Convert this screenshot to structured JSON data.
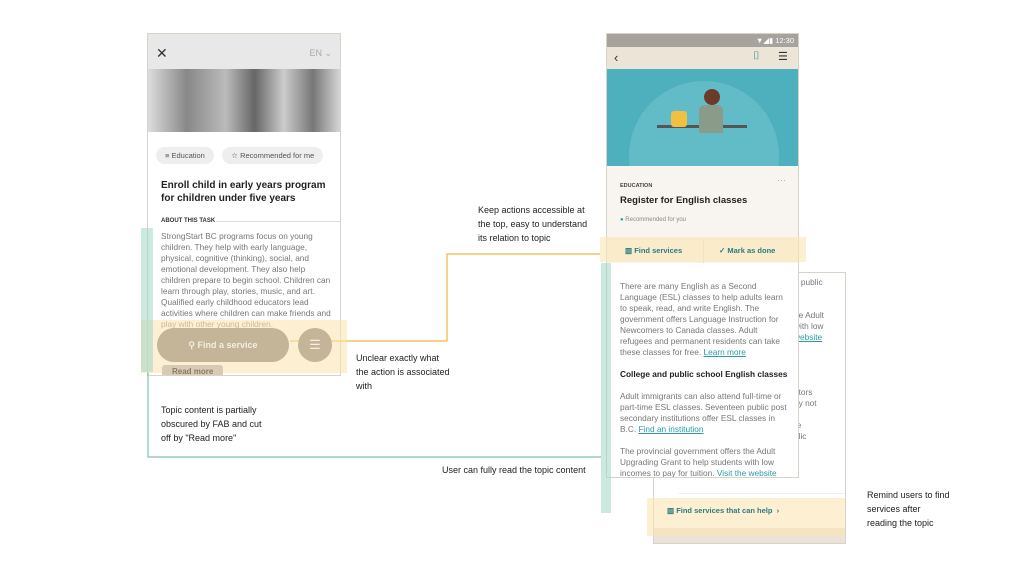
{
  "left_phone": {
    "lang": "EN",
    "tags": [
      "Education",
      "Recommended for me"
    ],
    "title": "Enroll child in early years program for children under five years",
    "section_label": "ABOUT THIS TASK",
    "body": "StrongStart BC programs focus on young children. They help with early language, physical, cognitive (thinking), social, and emotional development. They also help children prepare to begin school. Children can learn through play, stories, music, and art. Qualified early childhood educators lead activities where children can make friends and play with other young children.",
    "fab_label": "Find a service",
    "read_more": "Read more"
  },
  "right_phone": {
    "status_time": "12:30",
    "category": "EDUCATION",
    "title": "Register for English classes",
    "recommended": "Recommended for you",
    "find_services": "Find services",
    "mark_done": "Mark as done",
    "para1": "There are many English as a Second Language (ESL) classes to help adults learn to speak, read, and write English. The government offers Language Instruction for Newcomers to Canada classes. Adult refugees and permanent residents can take these classes for free.",
    "learn_more": "Learn more",
    "heading2": "College and public school English classes",
    "para2": "Adult immigrants can also attend full-time or part-time ESL classes. Seventeen public post secondary institutions offer ESL classes in B.C.",
    "find_institution": "Find an institution",
    "para3": "The provincial government offers the Adult Upgrading Grant to help students with low incomes to pay for tuition.",
    "visit_website": "Visit the website"
  },
  "back_panel": {
    "lines": [
      "n public",
      "L",
      "",
      "he Adult",
      "with low",
      "website",
      "",
      "s",
      "",
      "utors",
      "ay not",
      "",
      "re",
      "blic"
    ],
    "find_services_help": "Find services that can help"
  },
  "annotations": {
    "keep_actions": "Keep actions accessible at the top, easy to understand its relation to topic",
    "unclear_action": "Unclear exactly what the action is associated with",
    "topic_obscured": "Topic content is partially obscured by FAB and cut off by \"Read more\"",
    "fully_read": "User can fully read the topic content",
    "remind_users": "Remind users to find services after reading the topic"
  },
  "colors": {
    "accent": "#2a8c8c",
    "highlight_orange": "#fce4b2",
    "highlight_green": "#a0d7c8",
    "line_orange": "#f0b43c",
    "line_green": "#7cc4ae"
  }
}
